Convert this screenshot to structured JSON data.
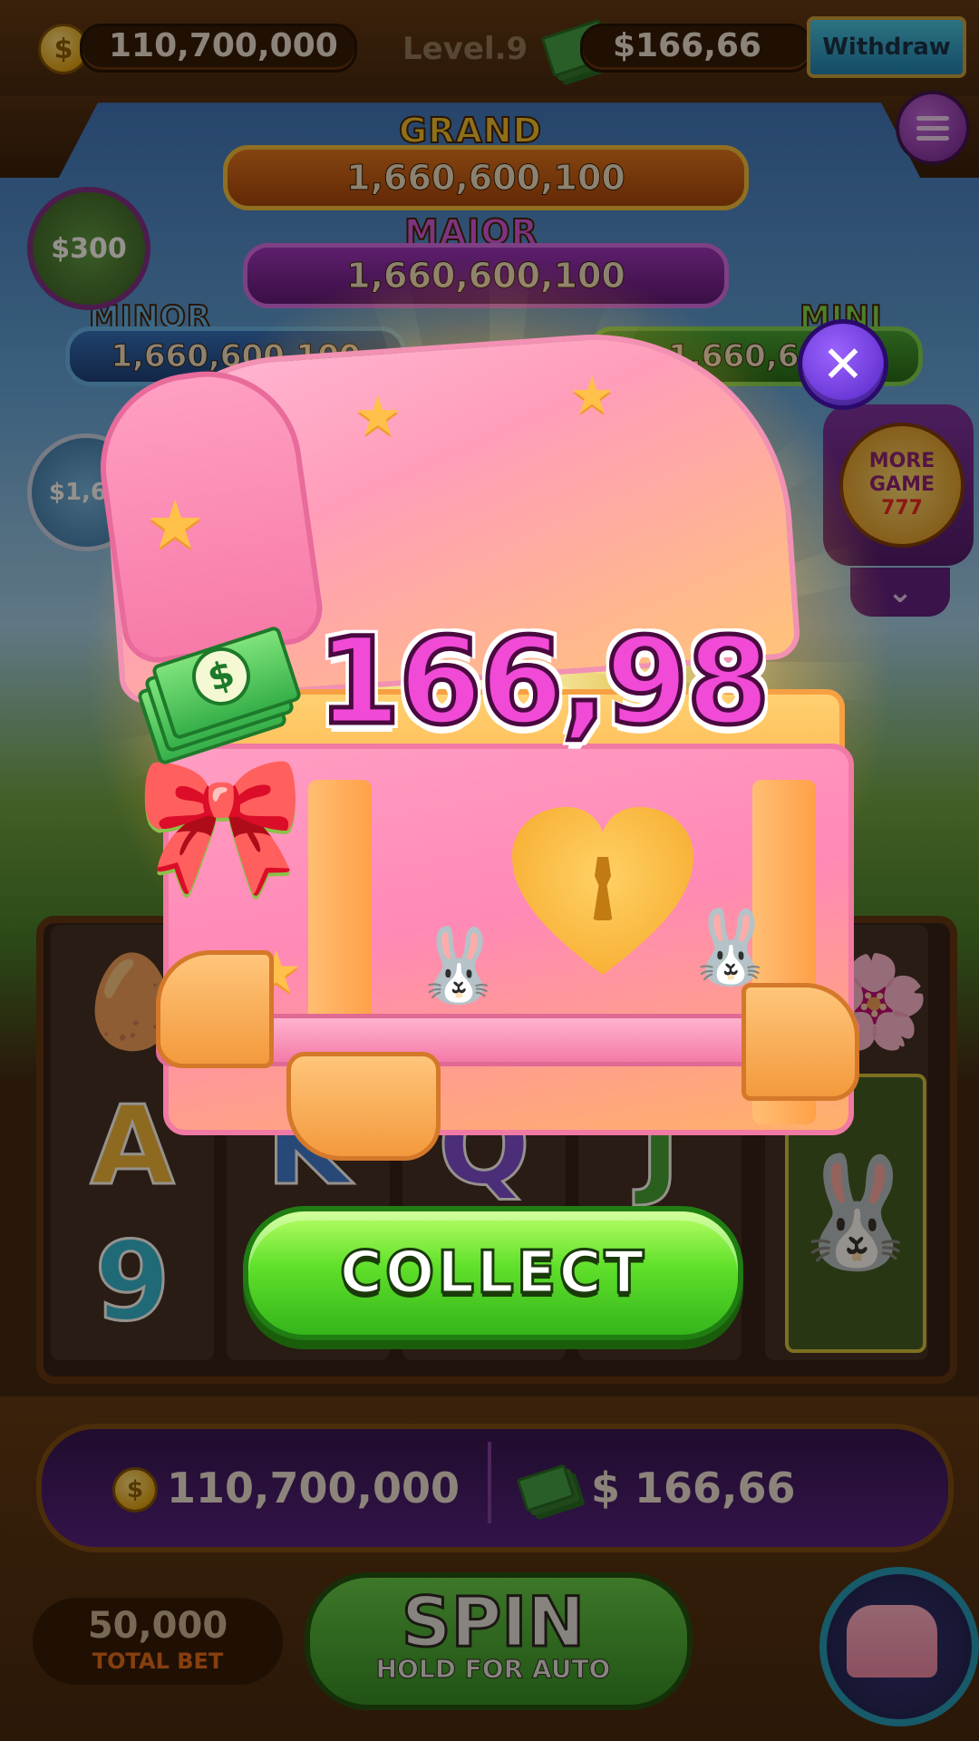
{
  "header": {
    "coin_balance": "110,700,000",
    "level": "Level.9",
    "cash_balance": "$166,66",
    "withdraw_label": "Withdraw"
  },
  "jackpots": {
    "grand_label": "GRAND",
    "grand_value": "1,660,600,100",
    "major_label": "MAJOR",
    "major_value": "1,660,600,100",
    "minor_label": "MINOR",
    "minor_value": "1,660,600,100",
    "mini_label": "MINI",
    "mini_value": "1,660,600",
    "cash_badge": "$300",
    "side_badge": "$1,66"
  },
  "side_panel": {
    "more_game_label_1": "MORE",
    "more_game_label_2": "GAME",
    "more_game_label_3": "777"
  },
  "reels": {
    "row1": [
      "🥚",
      "",
      "",
      "",
      "🌸"
    ],
    "row2": [
      "A",
      "K",
      "Q",
      "J",
      "🐰"
    ],
    "row3": [
      "9",
      "",
      "",
      "",
      ""
    ]
  },
  "popup": {
    "reward_amount": "166,98",
    "collect_label": "COLLECT",
    "close_symbol": "✕"
  },
  "bottom": {
    "coin_balance": "110,700,000",
    "cash_balance": "$ 166,66",
    "total_bet_value": "50,000",
    "total_bet_label": "TOTAL BET",
    "spin_label": "SPIN",
    "spin_sub_label": "HOLD FOR AUTO"
  },
  "colors": {
    "reward_text": "#f04ad6",
    "collect_button": "#5fe02a",
    "close_button": "#7a3eea",
    "withdraw_button": "#2aa8d8"
  },
  "icons": {
    "coin": "coin-icon",
    "cash": "cash-icon",
    "menu": "hamburger-menu-icon",
    "close": "close-icon",
    "chest": "treasure-chest-icon"
  }
}
